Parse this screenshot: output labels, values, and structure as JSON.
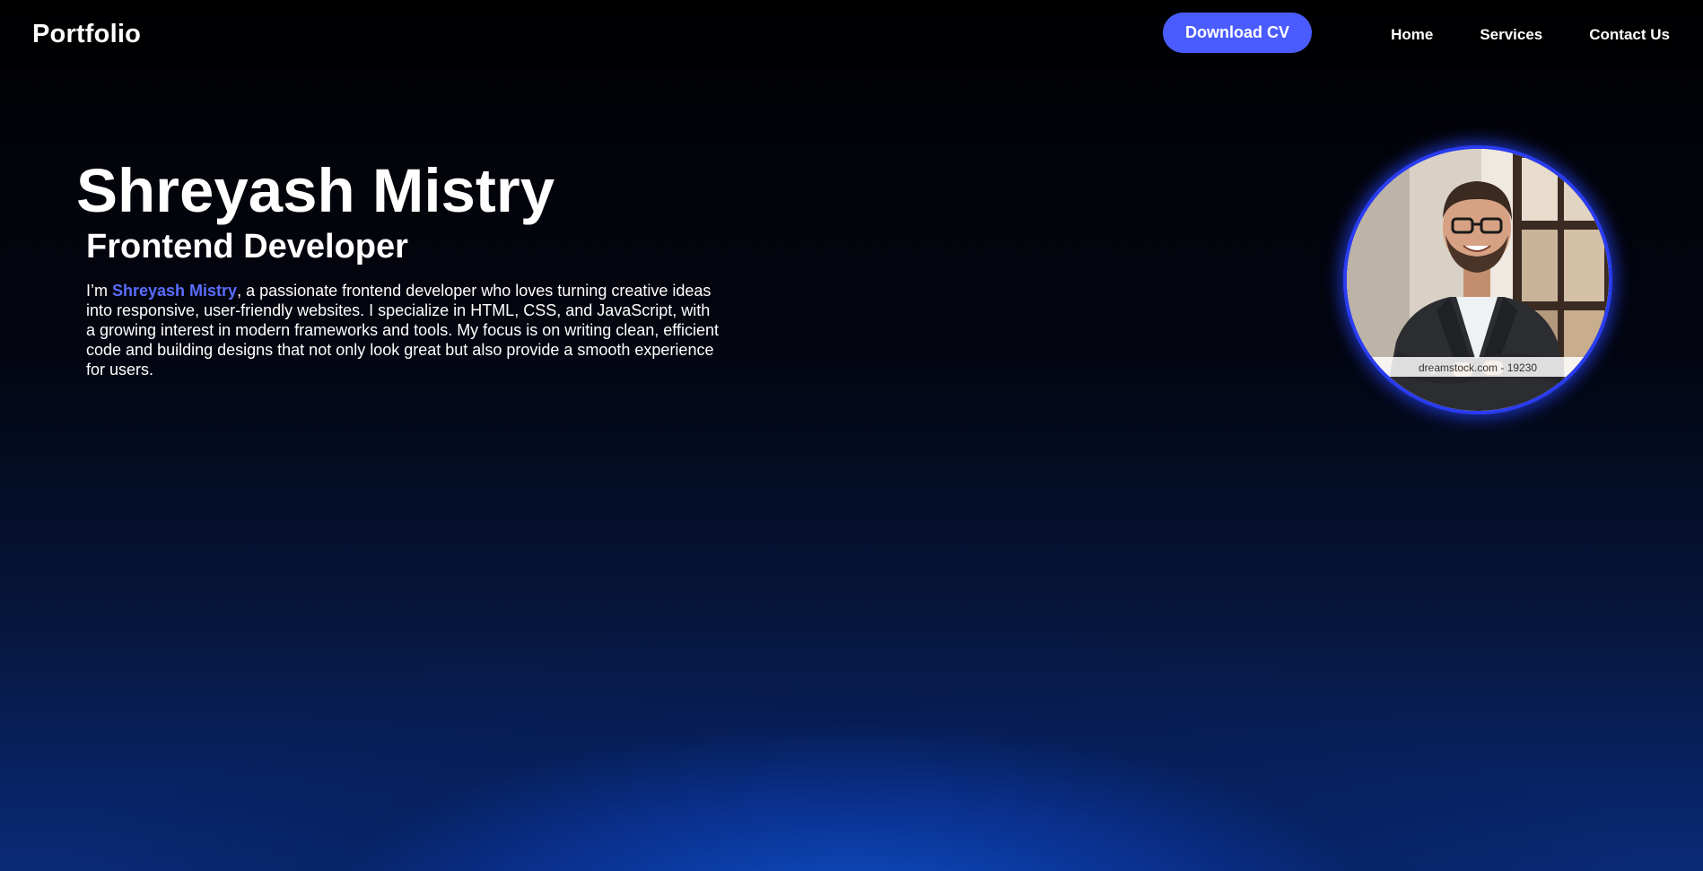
{
  "navbar": {
    "brand": "Portfolio",
    "cv_button": "Download CV",
    "links": [
      "Home",
      "Services",
      "Contact Us"
    ]
  },
  "hero": {
    "name": "Shreyash Mistry",
    "role": "Frontend Developer",
    "bio_prefix": "I’m ",
    "bio_highlight": "Shreyash Mistry",
    "bio_rest": ", a passionate frontend developer who loves turning creative ideas into responsive, user-friendly websites. I specialize in HTML, CSS, and JavaScript, with a growing interest in modern frameworks and tools. My focus is on writing clean, efficient code and building designs that not only look great but also provide a smooth experience for users."
  },
  "portrait": {
    "watermark": "dreamstock.com - 19230"
  },
  "colors": {
    "accent": "#4a5cff",
    "highlight": "#5a6dff",
    "ring": "#2a3cf0"
  }
}
